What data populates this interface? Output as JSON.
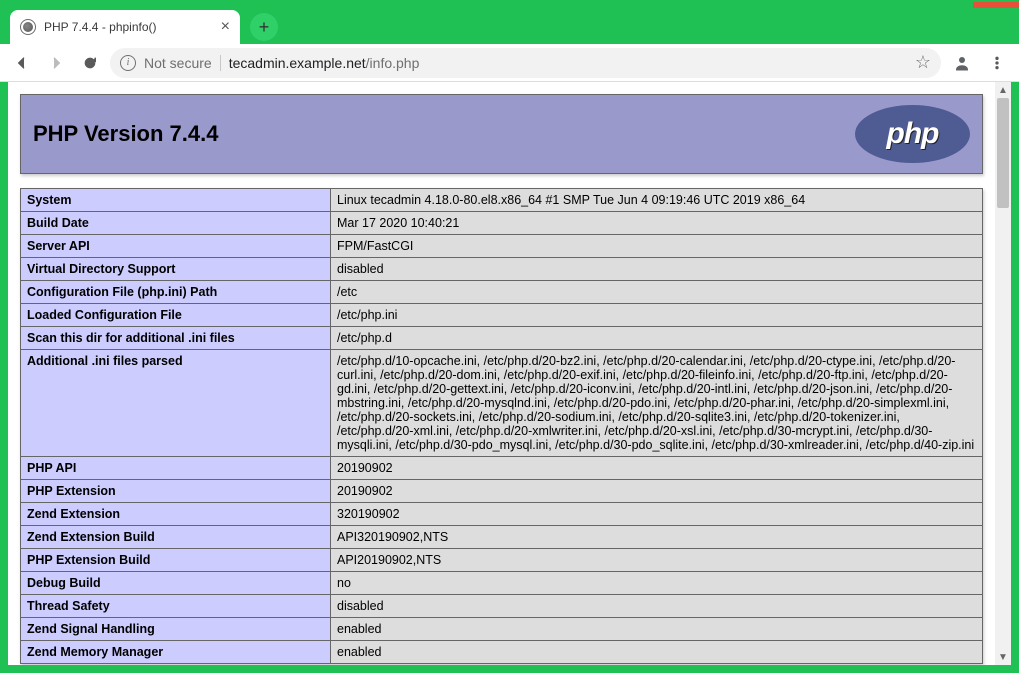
{
  "window": {
    "tab_title": "PHP 7.4.4 - phpinfo()"
  },
  "addressbar": {
    "not_secure": "Not secure",
    "host": "tecadmin.example.net",
    "path": "/info.php"
  },
  "phpinfo": {
    "title": "PHP Version 7.4.4",
    "logo_text": "php",
    "rows": [
      {
        "k": "System",
        "v": "Linux tecadmin 4.18.0-80.el8.x86_64 #1 SMP Tue Jun 4 09:19:46 UTC 2019 x86_64"
      },
      {
        "k": "Build Date",
        "v": "Mar 17 2020 10:40:21"
      },
      {
        "k": "Server API",
        "v": "FPM/FastCGI"
      },
      {
        "k": "Virtual Directory Support",
        "v": "disabled"
      },
      {
        "k": "Configuration File (php.ini) Path",
        "v": "/etc"
      },
      {
        "k": "Loaded Configuration File",
        "v": "/etc/php.ini"
      },
      {
        "k": "Scan this dir for additional .ini files",
        "v": "/etc/php.d"
      },
      {
        "k": "Additional .ini files parsed",
        "v": "/etc/php.d/10-opcache.ini, /etc/php.d/20-bz2.ini, /etc/php.d/20-calendar.ini, /etc/php.d/20-ctype.ini, /etc/php.d/20-curl.ini, /etc/php.d/20-dom.ini, /etc/php.d/20-exif.ini, /etc/php.d/20-fileinfo.ini, /etc/php.d/20-ftp.ini, /etc/php.d/20-gd.ini, /etc/php.d/20-gettext.ini, /etc/php.d/20-iconv.ini, /etc/php.d/20-intl.ini, /etc/php.d/20-json.ini, /etc/php.d/20-mbstring.ini, /etc/php.d/20-mysqlnd.ini, /etc/php.d/20-pdo.ini, /etc/php.d/20-phar.ini, /etc/php.d/20-simplexml.ini, /etc/php.d/20-sockets.ini, /etc/php.d/20-sodium.ini, /etc/php.d/20-sqlite3.ini, /etc/php.d/20-tokenizer.ini, /etc/php.d/20-xml.ini, /etc/php.d/20-xmlwriter.ini, /etc/php.d/20-xsl.ini, /etc/php.d/30-mcrypt.ini, /etc/php.d/30-mysqli.ini, /etc/php.d/30-pdo_mysql.ini, /etc/php.d/30-pdo_sqlite.ini, /etc/php.d/30-xmlreader.ini, /etc/php.d/40-zip.ini"
      },
      {
        "k": "PHP API",
        "v": "20190902"
      },
      {
        "k": "PHP Extension",
        "v": "20190902"
      },
      {
        "k": "Zend Extension",
        "v": "320190902"
      },
      {
        "k": "Zend Extension Build",
        "v": "API320190902,NTS"
      },
      {
        "k": "PHP Extension Build",
        "v": "API20190902,NTS"
      },
      {
        "k": "Debug Build",
        "v": "no"
      },
      {
        "k": "Thread Safety",
        "v": "disabled"
      },
      {
        "k": "Zend Signal Handling",
        "v": "enabled"
      },
      {
        "k": "Zend Memory Manager",
        "v": "enabled"
      }
    ]
  }
}
